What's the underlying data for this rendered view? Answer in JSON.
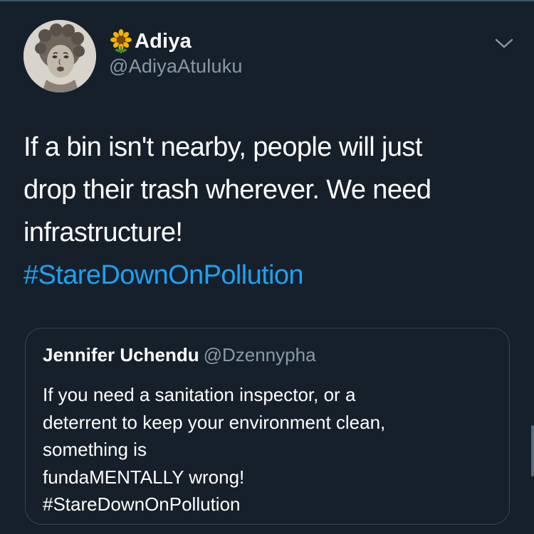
{
  "tweet": {
    "author": {
      "emoji_icon": "sunflower-icon",
      "display_name": "Adiya",
      "handle": "@AdiyaAtuluku"
    },
    "text_lines": [
      "If a bin isn't nearby, people will just",
      "drop their trash wherever. We need",
      "infrastructure!"
    ],
    "hashtag": "#StareDownOnPollution",
    "menu_icon": "chevron-down-icon"
  },
  "quoted_tweet": {
    "display_name": "Jennifer Uchendu",
    "handle": "@Dzennypha",
    "text_lines": [
      "If you need a sanitation inspector, or a",
      "deterrent to keep your environment clean,",
      "something is",
      "fundaMENTALLY wrong!",
      "#StareDownOnPollution"
    ]
  },
  "colors": {
    "background": "#15202b",
    "text": "#ffffff",
    "secondary_text": "#8899a6",
    "accent": "#1da1f2",
    "border": "#38444d"
  }
}
